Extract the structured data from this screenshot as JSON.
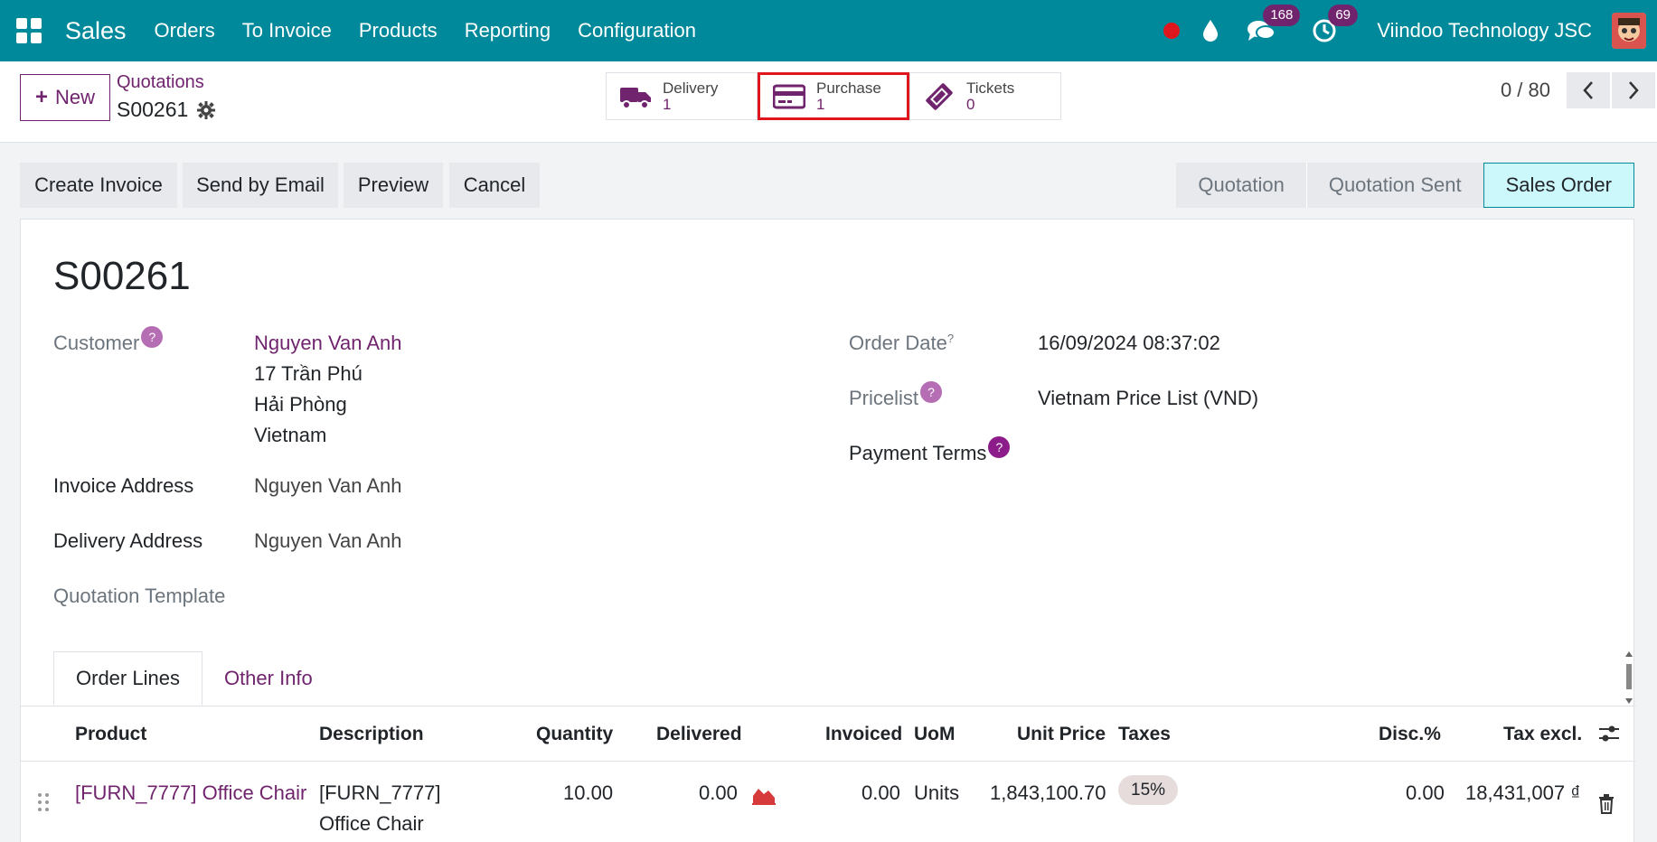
{
  "navbar": {
    "app_name": "Sales",
    "menu": [
      "Orders",
      "To Invoice",
      "Products",
      "Reporting",
      "Configuration"
    ],
    "messages_count": "168",
    "activities_count": "69",
    "company": "Viindoo Technology JSC",
    "colors": {
      "bg": "#00899a",
      "badge": "#71246e",
      "record": "#e0161e"
    }
  },
  "control_panel": {
    "new_label": "New",
    "breadcrumb": "Quotations",
    "record_name": "S00261",
    "smart_buttons": [
      {
        "label": "Delivery",
        "count": "1",
        "icon": "truck-icon"
      },
      {
        "label": "Purchase",
        "count": "1",
        "icon": "credit-card-icon"
      },
      {
        "label": "Tickets",
        "count": "0",
        "icon": "ticket-icon"
      }
    ],
    "pager": "0 / 80"
  },
  "actions": [
    "Create Invoice",
    "Send by Email",
    "Preview",
    "Cancel"
  ],
  "stages": {
    "items": [
      "Quotation",
      "Quotation Sent",
      "Sales Order"
    ],
    "active": "Sales Order"
  },
  "form": {
    "title": "S00261",
    "customer_label": "Customer",
    "customer_name": "Nguyen Van Anh",
    "customer_address": [
      "17 Trần Phú",
      "Hải Phòng",
      "Vietnam"
    ],
    "invoice_address_label": "Invoice Address",
    "invoice_address": "Nguyen Van Anh",
    "delivery_address_label": "Delivery Address",
    "delivery_address": "Nguyen Van Anh",
    "quotation_template_label": "Quotation Template",
    "order_date_label": "Order Date",
    "order_date": "16/09/2024 08:37:02",
    "pricelist_label": "Pricelist",
    "pricelist": "Vietnam Price List (VND)",
    "payment_terms_label": "Payment Terms",
    "help_mark": "?",
    "sup_mark": "?"
  },
  "tabs": [
    "Order Lines",
    "Other Info"
  ],
  "order_lines": {
    "columns": [
      "Product",
      "Description",
      "Quantity",
      "Delivered",
      "Invoiced",
      "UoM",
      "Unit Price",
      "Taxes",
      "Disc.%",
      "Tax excl."
    ],
    "rows": [
      {
        "product": "[FURN_7777] Office Chair",
        "description_1": "[FURN_7777]",
        "description_2": "Office Chair",
        "quantity": "10.00",
        "delivered": "0.00",
        "invoiced": "0.00",
        "uom": "Units",
        "unit_price": "1,843,100.70",
        "taxes": "15%",
        "discount": "0.00",
        "subtotal": "18,431,007 ₫"
      }
    ]
  }
}
